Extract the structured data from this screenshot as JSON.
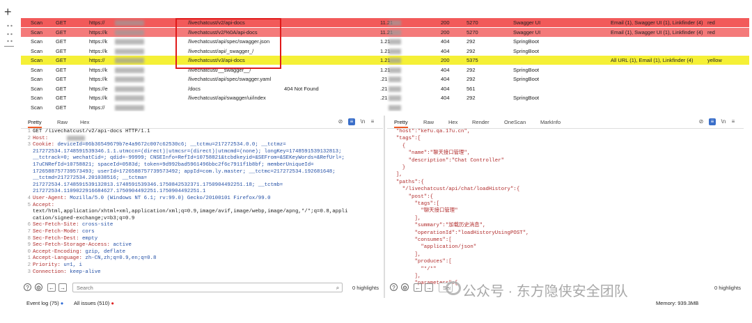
{
  "table": {
    "rows": [
      {
        "tool": "Scan",
        "method": "GET",
        "host": "https://",
        "url": "/livechatcust/v2/api-docs",
        "status": "",
        "ip": "11.21",
        "code": "200",
        "len": "5270",
        "mime": "Swagger UI",
        "issues": "Email (1), Swagger UI (1), Linkfinder (4)",
        "color": "red"
      },
      {
        "tool": "Scan",
        "method": "GET",
        "host": "https://k",
        "url": "/livechatcust/v2/%0A/api-docs",
        "status": "",
        "ip": "11.21",
        "code": "200",
        "len": "5270",
        "mime": "Swagger UI",
        "issues": "Email (1), Swagger UI (1), Linkfinder (4)",
        "color": "red"
      },
      {
        "tool": "Scan",
        "method": "GET",
        "host": "https://k",
        "url": "/livechatcust/api/spec/swagger.json",
        "status": "",
        "ip": "1.21",
        "code": "404",
        "len": "292",
        "mime": "SpringBoot",
        "issues": "",
        "color": ""
      },
      {
        "tool": "Scan",
        "method": "GET",
        "host": "https://k",
        "url": "/livechatcust/api/_swagger_/",
        "status": "",
        "ip": "1.21",
        "code": "404",
        "len": "292",
        "mime": "SpringBoot",
        "issues": "",
        "color": ""
      },
      {
        "tool": "Scan",
        "method": "GET",
        "host": "https://",
        "url": "/livechatcust/v3/api-docs",
        "status": "",
        "ip": "1.21",
        "code": "200",
        "len": "5375",
        "mime": "",
        "issues": "All URL (1), Email (1), Linkfinder (4)",
        "color": "yellow"
      },
      {
        "tool": "Scan",
        "method": "GET",
        "host": "https://k",
        "url": "/livechatcust/__swagger__/",
        "status": "",
        "ip": "1.21",
        "code": "404",
        "len": "292",
        "mime": "SpringBoot",
        "issues": "",
        "color": ""
      },
      {
        "tool": "Scan",
        "method": "GET",
        "host": "https://k",
        "url": "/livechatcust/api/spec/swagger.yaml",
        "status": "",
        "ip": ".21",
        "code": "404",
        "len": "292",
        "mime": "SpringBoot",
        "issues": "",
        "color": ""
      },
      {
        "tool": "Scan",
        "method": "GET",
        "host": "https://e",
        "url": "/docs",
        "status": "404 Not Found",
        "ip": ".21",
        "code": "404",
        "len": "561",
        "mime": "",
        "issues": "",
        "color": ""
      },
      {
        "tool": "Scan",
        "method": "GET",
        "host": "https://k",
        "url": "/livechatcust/api/swagger/ui/index",
        "status": "",
        "ip": ".21",
        "code": "404",
        "len": "292",
        "mime": "SpringBoot",
        "issues": "",
        "color": ""
      },
      {
        "tool": "Scan",
        "method": "GET",
        "host": "https://",
        "url": "",
        "status": "",
        "ip": "",
        "code": "",
        "len": "",
        "mime": "",
        "issues": "",
        "color": ""
      }
    ],
    "color_words": {
      "red": "red",
      "yellow": "yellow"
    }
  },
  "request_pane": {
    "tabs": [
      "Pretty",
      "Raw",
      "Hex"
    ],
    "icons": [
      "eye-slash-icon",
      "list-icon",
      "newline-icon",
      "menu-icon"
    ],
    "lines": [
      {
        "n": "1",
        "k": "",
        "v": "GET /livechatcust/v2/api-docs HTTP/1.1",
        "cls": "p"
      },
      {
        "n": "2",
        "k": "Host: ",
        "v": "",
        "cls": "k"
      },
      {
        "n": "3",
        "k": "Cookie: ",
        "v": "deviceId=06b36549679b7e4a9672c007c62530c6; __tctmu=217272534.0.0; __tctmz=",
        "cls": "k"
      },
      {
        "n": "",
        "k": "",
        "v": "217272534.1748591539346.1.1.utmccn=(direct)|utmcsr=(direct)|utmcmd=(none); longKey=1748591539132813;",
        "cls": "v"
      },
      {
        "n": "",
        "k": "",
        "v": "__tctrack=0; wechatCid=; qdid=-99999; CNSEInfo=RefId=10758821&tcbdkeyid=&SEFrom=&SEKeyWords=&RefUrl=;",
        "cls": "v"
      },
      {
        "n": "",
        "k": "",
        "v": "17uCNRefId=10758821; spaceId=0583d; token=9d992bad5961496bbc2f6c7911f1b8bf; memberUniqueId=",
        "cls": "v"
      },
      {
        "n": "",
        "k": "",
        "v": "1726588757739573493; userId=1726588757739573492; appId=com.ly.master; __tctmc=217272534.192681648;",
        "cls": "v"
      },
      {
        "n": "",
        "k": "",
        "v": "__tctmd=217272534.201038516; __tctma=",
        "cls": "v"
      },
      {
        "n": "",
        "k": "",
        "v": "217272534.1748591539132813.1748591539346.1750842532371.1750904492251.18; __tctmb=",
        "cls": "v"
      },
      {
        "n": "",
        "k": "",
        "v": "217272534.1109022916684627.1750904492251.1750904492251.1",
        "cls": "v"
      },
      {
        "n": "4",
        "k": "User-Agent: ",
        "v": "Mozilla/5.0 (Windows NT 6.1; rv:99.0) Gecko/20100101 Firefox/99.0",
        "cls": "k"
      },
      {
        "n": "5",
        "k": "Accept: ",
        "v": "",
        "cls": "k"
      },
      {
        "n": "",
        "k": "",
        "v": "text/html,application/xhtml+xml,application/xml;q=0.9,image/avif,image/webp,image/apng,*/*;q=0.8,appli",
        "cls": "p"
      },
      {
        "n": "",
        "k": "",
        "v": "cation/signed-exchange;v=b3;q=0.9",
        "cls": "p"
      },
      {
        "n": "6",
        "k": "Sec-Fetch-Site: ",
        "v": "cross-site",
        "cls": "k"
      },
      {
        "n": "7",
        "k": "Sec-Fetch-Mode: ",
        "v": "cors",
        "cls": "k"
      },
      {
        "n": "8",
        "k": "Sec-Fetch-Dest: ",
        "v": "empty",
        "cls": "k"
      },
      {
        "n": "9",
        "k": "Sec-Fetch-Storage-Access: ",
        "v": "active",
        "cls": "k"
      },
      {
        "n": "0",
        "k": "Accept-Encoding: ",
        "v": "gzip, deflate",
        "cls": "k"
      },
      {
        "n": "1",
        "k": "Accept-Language: ",
        "v": "zh-CN,zh;q=0.9,en;q=0.8",
        "cls": "k"
      },
      {
        "n": "2",
        "k": "Priority: ",
        "v": "u=1, i",
        "cls": "k"
      },
      {
        "n": "3",
        "k": "Connection: ",
        "v": "keep-alive",
        "cls": "k"
      }
    ]
  },
  "response_pane": {
    "tabs": [
      "Pretty",
      "Raw",
      "Hex",
      "Render",
      "OneScan",
      "MarkInfo"
    ],
    "icons": [
      "eye-slash-icon",
      "list-icon",
      "newline-icon",
      "menu-icon"
    ],
    "lines": [
      "  \"host\":\"kefu.qa.17u.cn\",",
      "  \"tags\":[",
      "    {",
      "      \"name\":\"聊天接口管理\",",
      "      \"description\":\"Chat Controller\"",
      "    }",
      "  ],",
      "  \"paths\":{",
      "    \"/livechatcust/api/chat/loadHistory\":{",
      "      \"post\":{",
      "        \"tags\":[",
      "          \"聊天接口管理\"",
      "        ],",
      "        \"summary\":\"加载历史消息\",",
      "        \"operationId\":\"loadHistoryUsingPOST\",",
      "        \"consumes\":[",
      "          \"application/json\"",
      "        ],",
      "        \"produces\":[",
      "          \"*/*\"",
      "        ],",
      "        \"parameters\":["
    ]
  },
  "search": {
    "placeholder": "Search",
    "highlights": "0 highlights",
    "highlights_right": "0 highlights"
  },
  "status": {
    "event_log": "Event log (75)",
    "all_issues": "All issues (510)",
    "memory": "Memory: 939.3MB"
  },
  "watermark": {
    "text": "公众号 · 东方隐侠安全团队"
  },
  "colors": {
    "red_row": "#f25a5a",
    "yellow_row": "#f5f036",
    "highlight_border": "#e01a1a",
    "accent": "#f05a24"
  }
}
